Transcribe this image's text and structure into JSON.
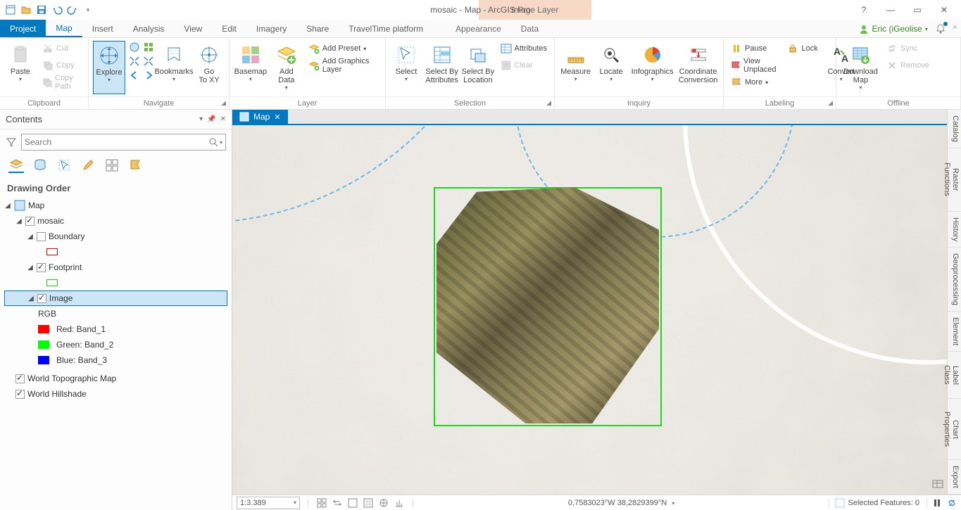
{
  "title": "mosaic - Map - ArcGIS Pro",
  "contextual_group": "Image Layer",
  "user": "Eric (iGeolise",
  "file_tab": "Project",
  "main_tabs": [
    "Map",
    "Insert",
    "Analysis",
    "View",
    "Edit",
    "Imagery",
    "Share",
    "TravelTime platform"
  ],
  "ctx_tabs": [
    "Appearance",
    "Data"
  ],
  "ribbon": {
    "clipboard": {
      "label": "Clipboard",
      "paste": "Paste",
      "cut": "Cut",
      "copy": "Copy",
      "copy_path": "Copy Path"
    },
    "navigate": {
      "label": "Navigate",
      "explore": "Explore",
      "bookmarks": "Bookmarks",
      "goto": "Go\nTo XY"
    },
    "layer": {
      "label": "Layer",
      "basemap": "Basemap",
      "add_data": "Add\nData",
      "add_preset": "Add Preset",
      "add_graphics": "Add Graphics Layer"
    },
    "selection": {
      "label": "Selection",
      "select": "Select",
      "by_attr": "Select By\nAttributes",
      "by_loc": "Select By\nLocation",
      "attributes": "Attributes",
      "clear": "Clear"
    },
    "inquiry": {
      "label": "Inquiry",
      "measure": "Measure",
      "locate": "Locate",
      "infographics": "Infographics",
      "coord": "Coordinate\nConversion"
    },
    "labeling": {
      "label": "Labeling",
      "pause": "Pause",
      "lock": "Lock",
      "view_unplaced": "View Unplaced",
      "more": "More",
      "convert": "Convert"
    },
    "offline": {
      "label": "Offline",
      "download": "Download\nMap",
      "sync": "Sync",
      "remove": "Remove"
    }
  },
  "contents": {
    "title": "Contents",
    "search_placeholder": "Search",
    "heading": "Drawing Order",
    "map": "Map",
    "mosaic": "mosaic",
    "boundary": "Boundary",
    "footprint": "Footprint",
    "image": "Image",
    "rgb": "RGB",
    "bands": {
      "red": "Red:   Band_1",
      "green": "Green: Band_2",
      "blue": "Blue:  Band_3"
    },
    "topo": "World Topographic Map",
    "hillshade": "World Hillshade"
  },
  "colors": {
    "boundary": "#e60000",
    "footprint": "#1cd61c",
    "red": "#ff0000",
    "green": "#00ff00",
    "blue": "#0000ff"
  },
  "view_tab": "Map",
  "status": {
    "scale": "1:3.389",
    "coords": "0,7583023°W 38,2829399°N",
    "selected": "Selected Features: 0"
  },
  "side_panels": [
    "Catalog",
    "Raster Functions",
    "History",
    "Geoprocessing",
    "Element",
    "Label Class",
    "Chart Properties",
    "Export"
  ]
}
